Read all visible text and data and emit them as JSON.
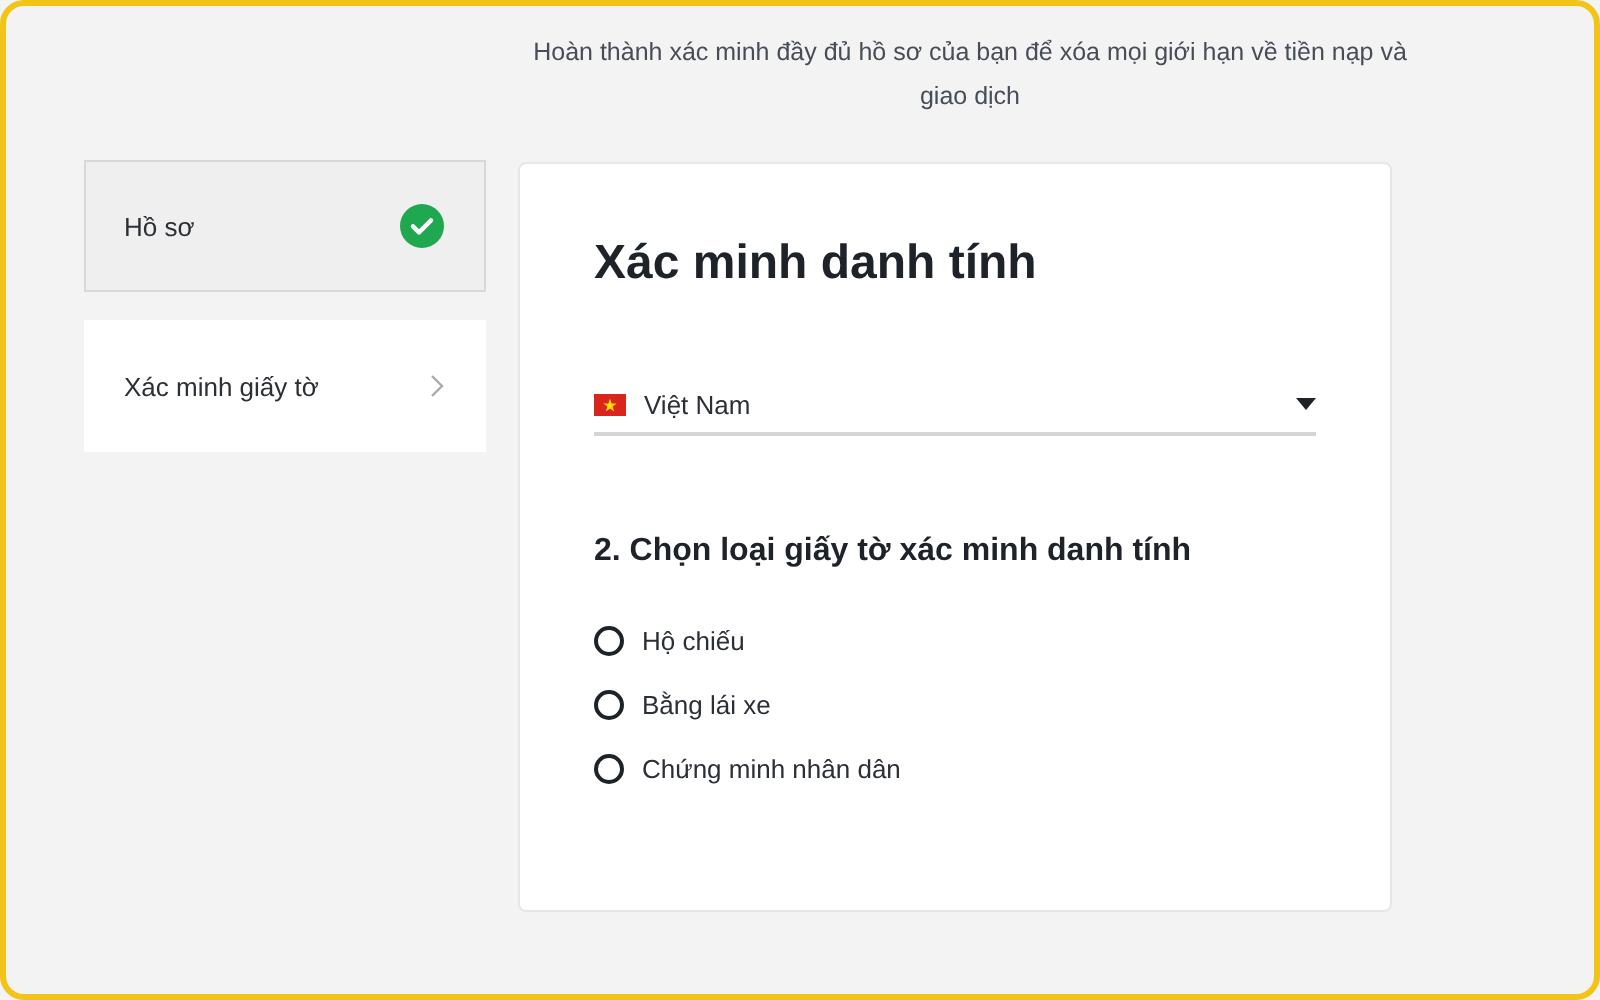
{
  "intro": "Hoàn thành xác minh đầy đủ hồ sơ của bạn để xóa mọi giới hạn về tiền nạp và giao dịch",
  "steps": [
    {
      "label": "Hồ sơ",
      "completed": true,
      "selected": false
    },
    {
      "label": "Xác minh giấy tờ",
      "completed": false,
      "selected": true
    }
  ],
  "card": {
    "title": "Xác minh danh tính",
    "country": {
      "value": "Việt Nam"
    },
    "section_title": "2. Chọn loại giấy tờ xác minh danh tính",
    "options": [
      {
        "label": "Hộ chiếu",
        "selected": false
      },
      {
        "label": "Bằng lái xe",
        "selected": false
      },
      {
        "label": "Chứng minh nhân dân",
        "selected": false
      }
    ]
  }
}
